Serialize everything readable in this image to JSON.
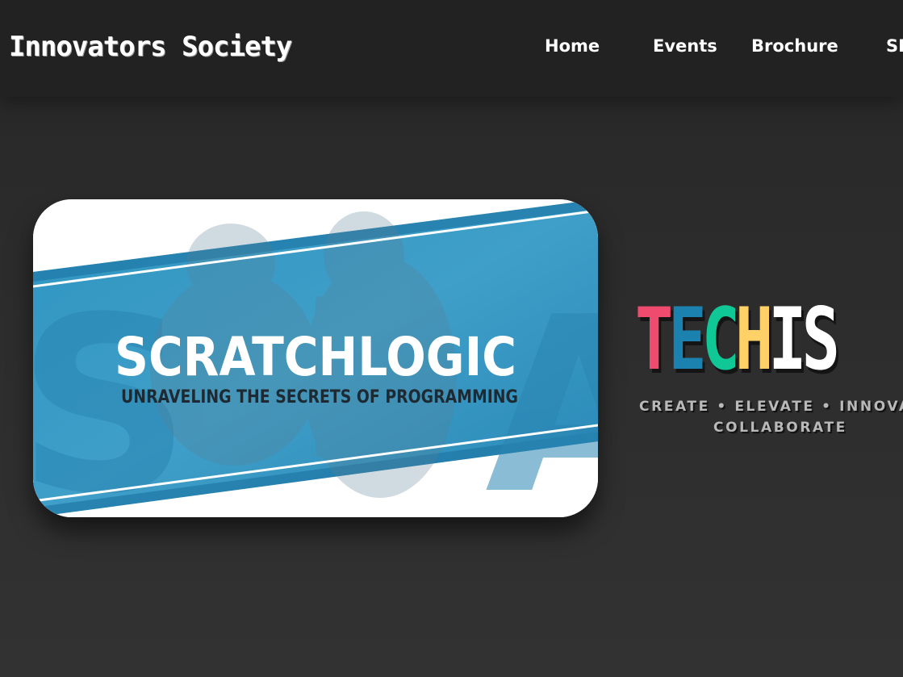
{
  "header": {
    "brand": "h Innovators Society",
    "nav": [
      {
        "label": "Home"
      },
      {
        "label": "Events"
      },
      {
        "label": "Brochure"
      },
      {
        "label": "SD"
      }
    ]
  },
  "hero": {
    "banner_title": "SCRATCHLOGIC",
    "banner_subtitle": "UNRAVELING THE SECRETS OF PROGRAMMING",
    "logo_chars": [
      {
        "char": "T",
        "color": "#ef4b6e"
      },
      {
        "char": "E",
        "color": "#1b82b0"
      },
      {
        "char": "C",
        "color": "#10c896"
      },
      {
        "char": "H",
        "color": "#ffd166"
      },
      {
        "char": "I",
        "color": "#ffffff"
      },
      {
        "char": "S",
        "color": "#ffffff"
      }
    ],
    "tagline_line1": "CREATE • ELEVATE • INNOVAT",
    "tagline_line2": "COLLABORATE"
  },
  "colors": {
    "background": "#2b2b2b",
    "navbar": "#222222",
    "banner_blue": "#2a93bf"
  }
}
